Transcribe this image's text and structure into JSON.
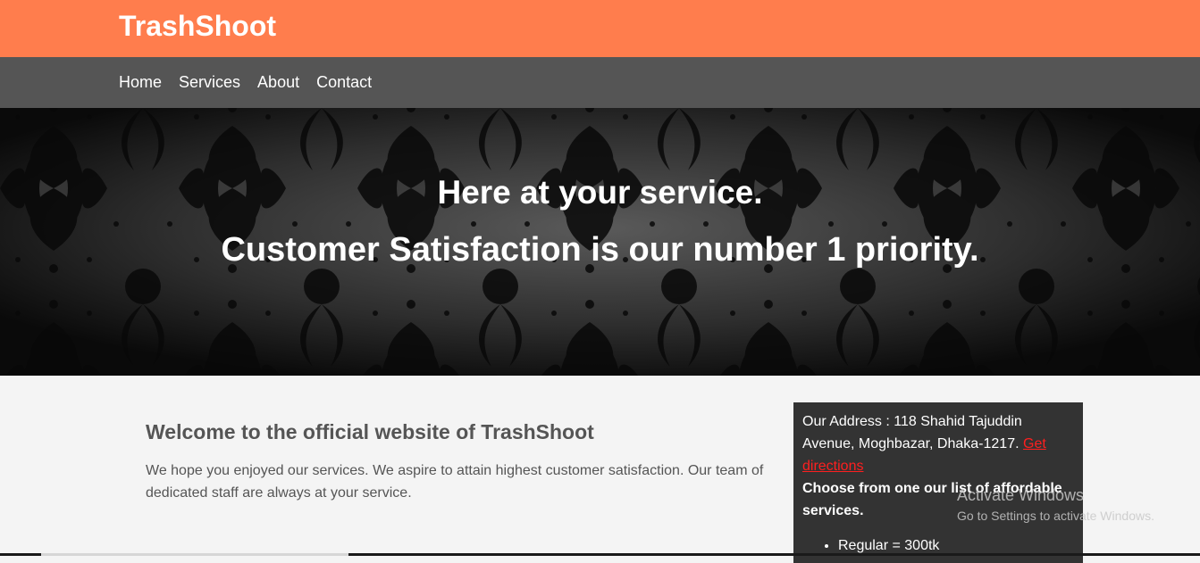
{
  "header": {
    "brand": "TrashShoot"
  },
  "nav": {
    "items": [
      "Home",
      "Services",
      "About",
      "Contact"
    ]
  },
  "hero": {
    "line1": "Here at your service.",
    "line2": "Customer Satisfaction is our number 1 priority."
  },
  "welcome": {
    "title": "Welcome to the official website of TrashShoot",
    "body": "We hope you enjoyed our services. We aspire to attain highest customer satisfaction. Our team of dedicated staff are always at your service."
  },
  "sidebar": {
    "address": "Our Address : 118 Shahid Tajuddin Avenue, Moghbazar, Dhaka-1217.",
    "directions_link": "Get directions",
    "choose_text": "Choose from one our list of affordable services.",
    "services": [
      "Regular = 300tk"
    ]
  },
  "watermark": {
    "title": "Activate Windows",
    "subtitle": "Go to Settings to activate Windows."
  },
  "colors": {
    "header_bg": "#ff7d4d",
    "nav_bg": "#555555",
    "sidebar_bg": "#333333",
    "link_red": "#ff1f1f"
  }
}
